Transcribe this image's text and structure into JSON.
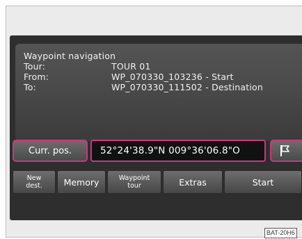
{
  "info": {
    "heading": "Waypoint navigation",
    "rows": [
      {
        "label": "Tour:",
        "value": "TOUR 01"
      },
      {
        "label": "From:",
        "value": "WP_070330_103236 - Start"
      },
      {
        "label": "To:",
        "value": "WP_070330_111502 - Destination"
      }
    ]
  },
  "position": {
    "button_label": "Curr. pos.",
    "coordinates": "52°24'38.9\"N 009°36'06.8\"O",
    "flag_icon": "flag-icon"
  },
  "bottom_bar": {
    "new_dest": [
      "New",
      "dest."
    ],
    "memory": "Memory",
    "waypoint_tour": [
      "Waypoint",
      "tour"
    ],
    "extras": "Extras",
    "start": "Start"
  },
  "figure_code": "BAT-20H6",
  "colors": {
    "highlight_border": "#c93a7a",
    "screen_background": "#2e2e2e",
    "panel_background": "#4a4a4a"
  }
}
